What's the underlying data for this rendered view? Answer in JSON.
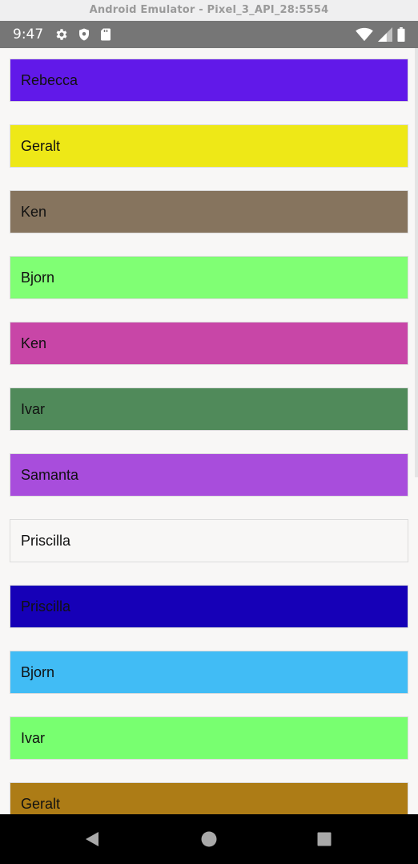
{
  "window": {
    "title": "Android Emulator - Pixel_3_API_28:5554"
  },
  "status_bar": {
    "time": "9:47",
    "left_icons": [
      "gear-icon",
      "shield-icon",
      "sd-card-icon"
    ],
    "right_icons": [
      "wifi-icon",
      "signal-icon",
      "battery-icon"
    ]
  },
  "list": {
    "items": [
      {
        "label": "Rebecca",
        "color": "#6119e9"
      },
      {
        "label": "Geralt",
        "color": "#eee817"
      },
      {
        "label": "Ken",
        "color": "#86745e"
      },
      {
        "label": "Bjorn",
        "color": "#80ff74"
      },
      {
        "label": "Ken",
        "color": "#c846a7"
      },
      {
        "label": "Ivar",
        "color": "#508a5a"
      },
      {
        "label": "Samanta",
        "color": "#a84ddc"
      },
      {
        "label": "Priscilla",
        "color": "#f8f7f6"
      },
      {
        "label": "Priscilla",
        "color": "#1600b7"
      },
      {
        "label": "Bjorn",
        "color": "#41bcf5"
      },
      {
        "label": "Ivar",
        "color": "#78ff70"
      },
      {
        "label": "Geralt",
        "color": "#ad7c16"
      }
    ]
  },
  "nav_bar": {
    "buttons": [
      "back-icon",
      "home-icon",
      "recents-icon"
    ]
  }
}
